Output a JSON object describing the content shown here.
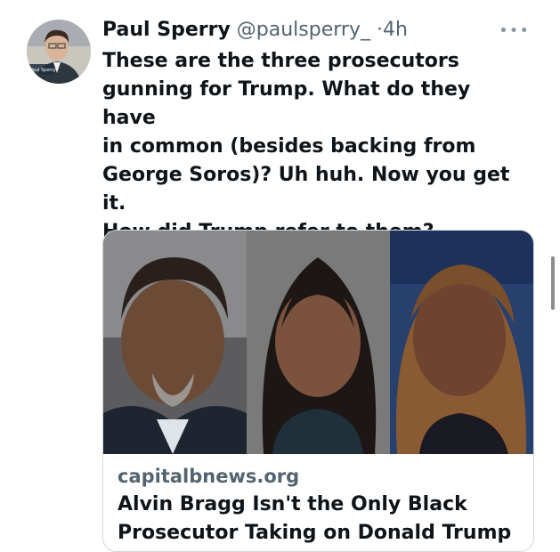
{
  "tweet": {
    "author_name": "Paul Sperry",
    "handle": "@paulsperry_",
    "separator": "·",
    "time": "4h",
    "more_icon": "more-horizontal-icon",
    "text": "These are the three prosecutors\ngunning for Trump. What do they have\nin common (besides backing from\nGeorge Soros)? Uh huh. Now you get it.\nHow did Trump refer to them? ...\n\"Racists in reverse\""
  },
  "avatar": {
    "caption": "Paul Sperry"
  },
  "link_card": {
    "domain": "capitalbnews.org",
    "title": "Alvin Bragg Isn't the Only Black\nProsecutor Taking on Donald Trump"
  }
}
